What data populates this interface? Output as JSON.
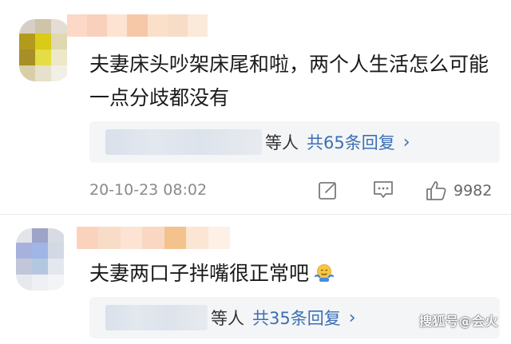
{
  "comments": [
    {
      "text": "夫妻床头吵架床尾和啦，两个人生活怎么可能一点分歧都没有",
      "reply_who": "等人",
      "reply_count": "共65条回复",
      "timestamp": "20-10-23 08:02",
      "like_count": "9982"
    },
    {
      "text": "夫妻两口子拌嘴很正常吧",
      "emoji": "shrug-emoji",
      "reply_who": "等人",
      "reply_count": "共35条回复"
    }
  ],
  "icons": {
    "repost": "edit-icon",
    "comment": "comment-icon",
    "like": "thumbs-up-icon",
    "reply_chevron": "chevron-right-icon"
  },
  "watermark": "搜狐号@会火",
  "colors": {
    "link": "#3b6fb3",
    "reply_bg": "#f4f5f7",
    "meta": "#8a8a8a"
  }
}
